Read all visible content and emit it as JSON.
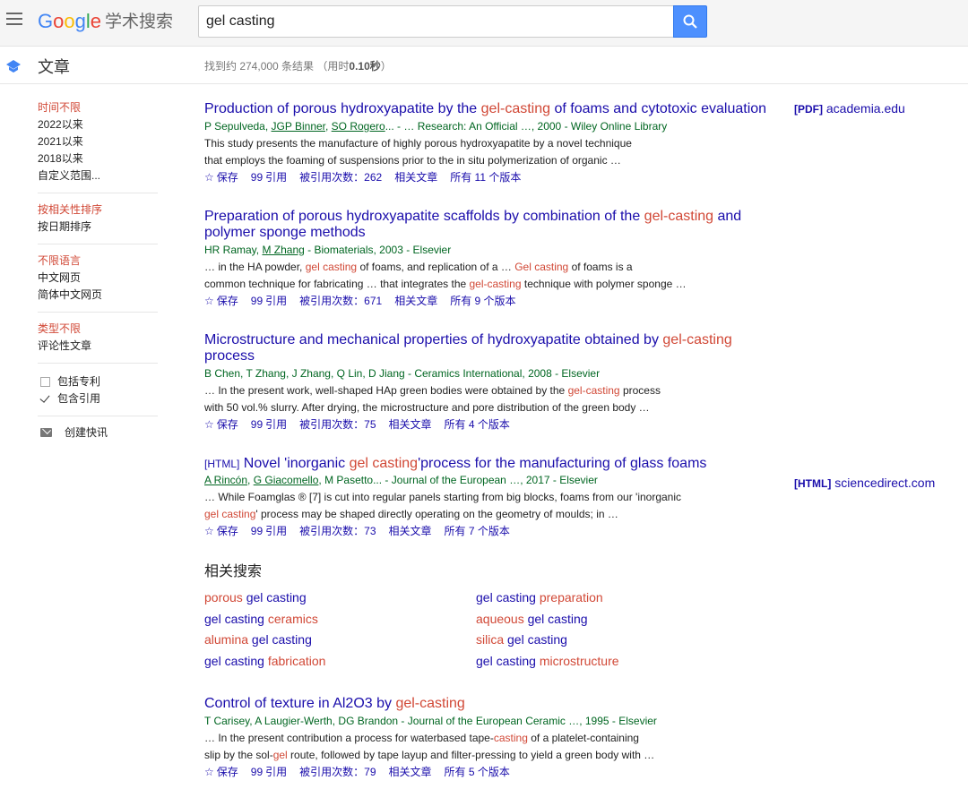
{
  "header": {
    "logo_google": [
      "G",
      "o",
      "o",
      "g",
      "l",
      "e"
    ],
    "logo_scholar": "学术搜索",
    "search_value": "gel casting"
  },
  "subbar": {
    "articles": "文章",
    "stats_prefix": "找到约 274,000 条结果 （用时",
    "stats_time": "0.10秒",
    "stats_suffix": "）"
  },
  "sidebar": {
    "time": [
      "时间不限",
      "2022以来",
      "2021以来",
      "2018以来",
      "自定义范围..."
    ],
    "sort": [
      "按相关性排序",
      "按日期排序"
    ],
    "lang": [
      "不限语言",
      "中文网页",
      "简体中文网页"
    ],
    "type": [
      "类型不限",
      "评论性文章"
    ],
    "include_patents": "包括专利",
    "include_citations": "包含引用",
    "create_alert": "创建快讯"
  },
  "actions": {
    "save": "保存",
    "cite": "引用",
    "related": "相关文章"
  },
  "results": [
    {
      "title_a": "Production of porous hydroxyapatite by the ",
      "title_hl": "gel-casting",
      "title_b": " of foams and cytotoxic evaluation",
      "authors_plain_a": "P Sepulveda, ",
      "authors_link_1": "JGP Binner",
      "authors_sep": ", ",
      "authors_link_2": "SO Rogero",
      "authors_rest": "... - … Research: An Official …, 2000 - Wiley Online Library",
      "snippet_1": "This study presents the manufacture of highly porous hydroxyapatite by a novel technique",
      "snippet_2": "that employs the foaming of suspensions prior to the in situ polymerization of organic …",
      "cited": "被引用次数：262",
      "versions": "所有 11 个版本",
      "side_tag": "[PDF]",
      "side_source": "academia.edu"
    },
    {
      "title_a": "Preparation of porous hydroxyapatite scaffolds by combination of the ",
      "title_hl": "gel-casting",
      "title_b": " and polymer sponge methods",
      "authors_plain_a": "HR Ramay, ",
      "authors_link_1": "M Zhang",
      "authors_rest": " - Biomaterials, 2003 - Elsevier",
      "snippet_1a": "… in the HA powder, ",
      "snippet_1hl": "gel casting",
      "snippet_1b": " of foams, and replication of a … ",
      "snippet_1hl2": "Gel casting",
      "snippet_1c": " of foams is a",
      "snippet_2a": "common technique for fabricating … that integrates the ",
      "snippet_2hl": "gel-casting",
      "snippet_2b": " technique with polymer sponge …",
      "cited": "被引用次数：671",
      "versions": "所有 9 个版本"
    },
    {
      "title_a": "Microstructure and mechanical properties of hydroxyapatite obtained by ",
      "title_hl": "gel-casting",
      "title_b": " process",
      "authors": "B Chen, T Zhang, J Zhang, Q Lin, D Jiang - Ceramics International, 2008 - Elsevier",
      "snippet_1a": "… In the present work, well-shaped HAp green bodies were obtained by the ",
      "snippet_1hl": "gel-casting",
      "snippet_1b": " process",
      "snippet_2": "with 50 vol.% slurry. After drying, the microstructure and pore distribution of the green body …",
      "cited": "被引用次数：75",
      "versions": "所有 4 个版本"
    },
    {
      "title_tag": "[HTML]",
      "title_a": " Novel 'inorganic ",
      "title_hl": "gel casting",
      "title_b": "'process for the manufacturing of glass foams",
      "authors_link_1": "A Rincón",
      "authors_sep": ", ",
      "authors_link_2": "G Giacomello",
      "authors_rest": ", M Pasetto... - Journal of the European …, 2017 - Elsevier",
      "snippet_1": "… While Foamglas ® [7] is cut into regular panels starting from big blocks, foams from our 'inorganic",
      "snippet_2hl": "gel casting",
      "snippet_2b": "' process may be shaped directly operating on the geometry of moulds; in …",
      "cited": "被引用次数：73",
      "versions": "所有 7 个版本",
      "side_tag": "[HTML]",
      "side_source": "sciencedirect.com"
    },
    {
      "title_a": "Control of texture in Al2O3 by ",
      "title_hl": "gel-casting",
      "authors": "T Carisey, A Laugier-Werth, DG Brandon - Journal of the European Ceramic …, 1995 - Elsevier",
      "snippet_1a": "… In the present contribution a process for waterbased tape-",
      "snippet_1hl": "casting",
      "snippet_1b": " of a platelet-containing",
      "snippet_2a": "slip by the sol-",
      "snippet_2hl": "gel",
      "snippet_2b": " route, followed by tape layup and filter-pressing to yield a green body with …",
      "cited": "被引用次数：79",
      "versions": "所有 5 个版本"
    }
  ],
  "related": {
    "title": "相关搜索",
    "items": [
      {
        "a": "porous ",
        "b": "gel casting",
        "hl_first": true
      },
      {
        "a": "gel casting ",
        "b": "preparation",
        "hl_first": false
      },
      {
        "a": "gel casting ",
        "b": "ceramics",
        "hl_first": false
      },
      {
        "a": "aqueous ",
        "b": "gel casting",
        "hl_first": true
      },
      {
        "a": "alumina ",
        "b": "gel casting",
        "hl_first": true
      },
      {
        "a": "silica ",
        "b": "gel casting",
        "hl_first": true
      },
      {
        "a": "gel casting ",
        "b": "fabrication",
        "hl_first": false
      },
      {
        "a": "gel casting ",
        "b": "microstructure",
        "hl_first": false
      }
    ]
  }
}
